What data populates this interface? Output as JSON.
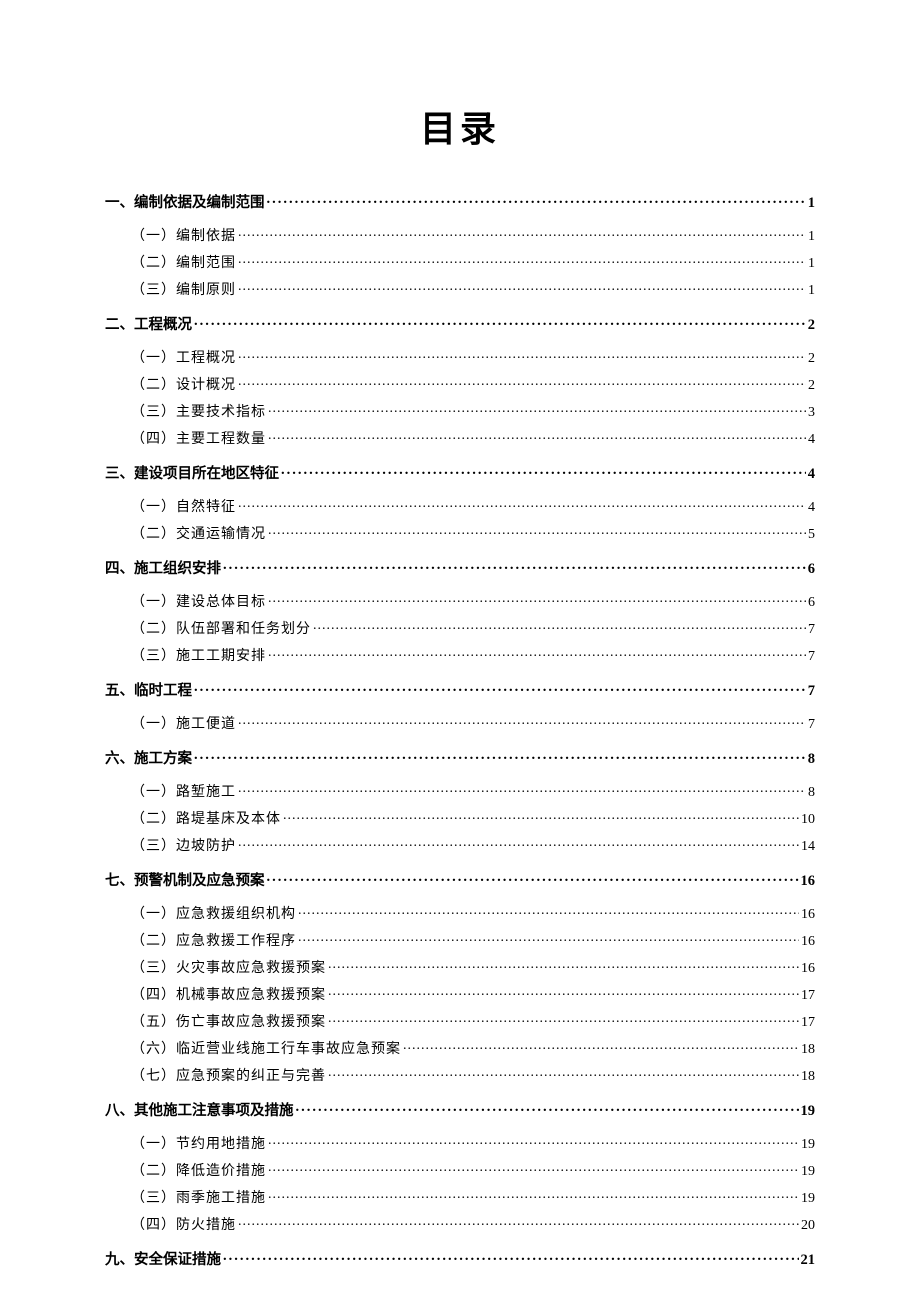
{
  "title": "目录",
  "entries": [
    {
      "level": 1,
      "label": "一、编制依据及编制范围",
      "page": "1"
    },
    {
      "level": 2,
      "label": "（一）编制依据",
      "page": "1"
    },
    {
      "level": 2,
      "label": "（二）编制范围",
      "page": "1"
    },
    {
      "level": 2,
      "label": "（三）编制原则",
      "page": "1"
    },
    {
      "level": 1,
      "label": "二、工程概况",
      "page": "2"
    },
    {
      "level": 2,
      "label": "（一）工程概况",
      "page": "2"
    },
    {
      "level": 2,
      "label": "（二）设计概况",
      "page": "2"
    },
    {
      "level": 2,
      "label": "（三）主要技术指标",
      "page": "3"
    },
    {
      "level": 2,
      "label": "（四）主要工程数量",
      "page": "4"
    },
    {
      "level": 1,
      "label": "三、建设项目所在地区特征",
      "page": "4"
    },
    {
      "level": 2,
      "label": "（一）自然特征",
      "page": "4"
    },
    {
      "level": 2,
      "label": "（二）交通运输情况",
      "page": "5"
    },
    {
      "level": 1,
      "label": "四、施工组织安排",
      "page": "6"
    },
    {
      "level": 2,
      "label": "（一）建设总体目标",
      "page": "6"
    },
    {
      "level": 2,
      "label": "（二）队伍部署和任务划分",
      "page": "7"
    },
    {
      "level": 2,
      "label": "（三）施工工期安排",
      "page": "7"
    },
    {
      "level": 1,
      "label": "五、临时工程",
      "page": "7"
    },
    {
      "level": 2,
      "label": "（一）施工便道",
      "page": "7"
    },
    {
      "level": 1,
      "label": "六、施工方案",
      "page": "8"
    },
    {
      "level": 2,
      "label": "（一）路堑施工",
      "page": "8"
    },
    {
      "level": 2,
      "label": "（二）路堤基床及本体",
      "page": "10"
    },
    {
      "level": 2,
      "label": "（三）边坡防护",
      "page": "14"
    },
    {
      "level": 1,
      "label": "七、预警机制及应急预案",
      "page": "16"
    },
    {
      "level": 2,
      "label": "（一）应急救援组织机构",
      "page": "16"
    },
    {
      "level": 2,
      "label": "（二）应急救援工作程序",
      "page": "16"
    },
    {
      "level": 2,
      "label": "（三）火灾事故应急救援预案",
      "page": "16"
    },
    {
      "level": 2,
      "label": "（四）机械事故应急救援预案",
      "page": "17"
    },
    {
      "level": 2,
      "label": "（五）伤亡事故应急救援预案",
      "page": "17"
    },
    {
      "level": 2,
      "label": "（六）临近营业线施工行车事故应急预案",
      "page": "18"
    },
    {
      "level": 2,
      "label": "（七）应急预案的纠正与完善",
      "page": "18"
    },
    {
      "level": 1,
      "label": "八、其他施工注意事项及措施",
      "page": "19"
    },
    {
      "level": 2,
      "label": "（一）节约用地措施",
      "page": "19"
    },
    {
      "level": 2,
      "label": "（二）降低造价措施",
      "page": "19"
    },
    {
      "level": 2,
      "label": "（三）雨季施工措施",
      "page": "19"
    },
    {
      "level": 2,
      "label": "（四）防火措施",
      "page": "20"
    },
    {
      "level": 1,
      "label": "九、安全保证措施",
      "page": "21"
    }
  ]
}
